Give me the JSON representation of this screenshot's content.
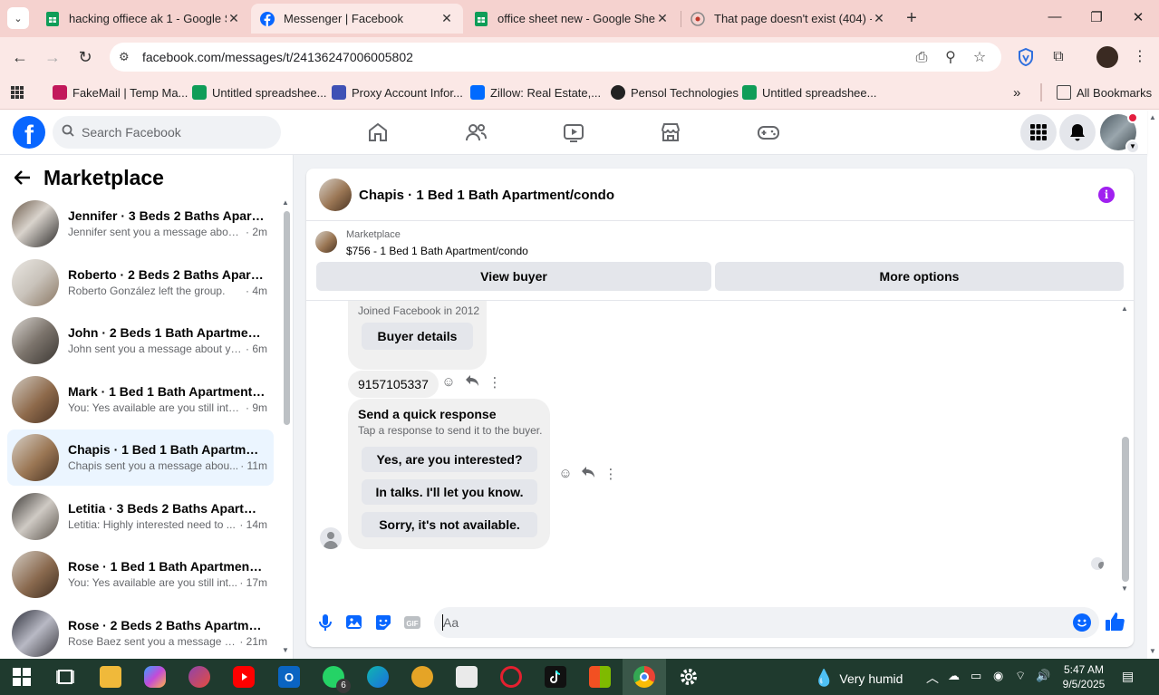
{
  "browser": {
    "tabs": [
      {
        "title": "hacking offiece ak 1 - Google Sh",
        "favicon": "sheets-icon",
        "active": false
      },
      {
        "title": "Messenger | Facebook",
        "favicon": "facebook-icon",
        "active": true
      },
      {
        "title": "office sheet new - Google Sheet",
        "favicon": "sheets-icon",
        "active": false
      },
      {
        "title": "That page doesn't exist (404) - F",
        "favicon": "error-page-icon",
        "active": false
      }
    ],
    "url": "facebook.com/messages/t/24136247006005802",
    "bookmarks": [
      {
        "label": "FakeMail | Temp Ma...",
        "color": "#c2185b"
      },
      {
        "label": "Untitled spreadshee...",
        "color": "#0f9d58"
      },
      {
        "label": "Proxy Account Infor...",
        "color": "#3f51b5"
      },
      {
        "label": "Zillow: Real Estate,...",
        "color": "#006aff"
      },
      {
        "label": "Pensol Technologies",
        "color": "#222222"
      },
      {
        "label": "Untitled spreadshee...",
        "color": "#0f9d58"
      }
    ],
    "all_bookmarks": "All Bookmarks"
  },
  "facebook": {
    "search_placeholder": "Search Facebook",
    "brand_color": "#0866ff"
  },
  "sidebar": {
    "title": "Marketplace",
    "conversations": [
      {
        "name": "Jennifer · 3 Beds 2 Baths Apart...",
        "snippet": "Jennifer sent you a message about...",
        "time": "· 2m",
        "active": false
      },
      {
        "name": "Roberto · 2 Beds 2 Baths Apart...",
        "snippet": "Roberto González left the group.",
        "time": "· 4m",
        "active": false
      },
      {
        "name": "John · 2 Beds 1 Bath Apartment/...",
        "snippet": "John sent you a message about yo...",
        "time": "· 6m",
        "active": false
      },
      {
        "name": "Mark · 1 Bed 1 Bath Apartment/...",
        "snippet": "You: Yes available are you still inter...",
        "time": "· 9m",
        "active": false
      },
      {
        "name": "Chapis · 1 Bed 1 Bath Apartment...",
        "snippet": "Chapis sent you a message abou...",
        "time": "· 11m",
        "active": true
      },
      {
        "name": "Letitia · 3 Beds 2 Baths Apartme...",
        "snippet": "Letitia: Highly interested need to ...",
        "time": "· 14m",
        "active": false
      },
      {
        "name": "Rose · 1 Bed 1 Bath Apartment/c...",
        "snippet": "You: Yes available are you still int...",
        "time": "· 17m",
        "active": false
      },
      {
        "name": "Rose · 2 Beds 2 Baths Apartmen...",
        "snippet": "Rose Baez sent you a message a...",
        "time": "· 21m",
        "active": false
      }
    ]
  },
  "chat": {
    "title": "Chapis · 1 Bed 1 Bath Apartment/condo",
    "listing_label": "Marketplace",
    "listing_price": "$756 - 1 Bed 1 Bath Apartment/condo",
    "view_buyer": "View buyer",
    "more_options": "More options",
    "joined": "Joined Facebook in 2012",
    "buyer_details": "Buyer details",
    "phone_message": "9157105337",
    "quick_title": "Send a quick response",
    "quick_subtitle": "Tap a response to send it to the buyer.",
    "quick_responses": [
      "Yes, are you interested?",
      "In talks. I'll let you know.",
      "Sorry, it's not available."
    ],
    "composer_placeholder": "Aa"
  },
  "taskbar": {
    "weather": "Very humid",
    "time": "5:47 AM",
    "date": "9/5/2025",
    "whatsapp_badge": "6"
  }
}
